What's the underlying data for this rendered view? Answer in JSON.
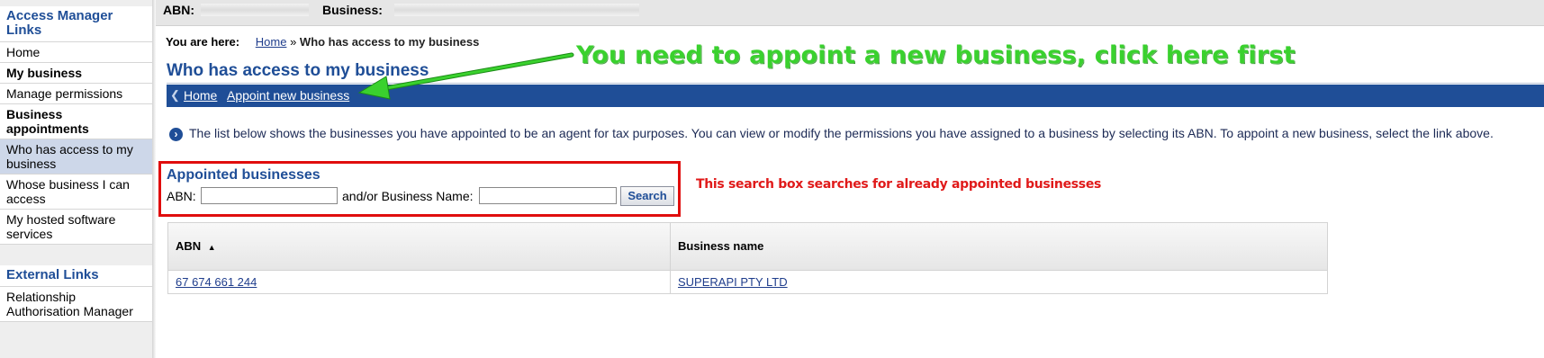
{
  "sidebar": {
    "title": "Access Manager Links",
    "items": [
      {
        "label": "Home"
      },
      {
        "label": "My business"
      },
      {
        "label": "Manage permissions"
      },
      {
        "label": "Business appointments"
      },
      {
        "label": "Who has access to my business"
      },
      {
        "label": "Whose business I can access"
      },
      {
        "label": "My hosted software services"
      }
    ],
    "selected": "Who has access to my business",
    "external_title": "External Links",
    "external_items": [
      {
        "label": "Relationship Authorisation Manager"
      }
    ]
  },
  "header": {
    "abn_label": "ABN:",
    "business_label": "Business:"
  },
  "breadcrumb": {
    "label": "You are here:",
    "home": "Home",
    "separator": "»",
    "current": "Who has access to my business"
  },
  "page_title": "Who has access to my business",
  "nav": {
    "back_icon": "chevron-left-icon",
    "home": "Home",
    "appoint": "Appoint new business"
  },
  "info": {
    "icon": "chevron-right-circle-icon",
    "text": "The list below shows the businesses you have appointed to be an agent for tax purposes. You can view or modify the permissions you have assigned to a business by selecting its ABN. To appoint a new business, select the link above."
  },
  "search": {
    "title": "Appointed businesses",
    "abn_label": "ABN:",
    "abn_value": "",
    "name_label": "and/or Business Name:",
    "name_value": "",
    "button": "Search"
  },
  "annotations": {
    "green": "You need to appoint a new business, click here first",
    "red": "This search box searches for already appointed businesses"
  },
  "table": {
    "columns": [
      "ABN",
      "Business name"
    ],
    "sort_icon": "sort-ascending-icon",
    "rows": [
      {
        "abn": "67 674 661 244",
        "name": "SUPERAPI PTY LTD"
      }
    ]
  },
  "colors": {
    "brand_blue": "#1f4e97",
    "annotation_green": "#3ad12e",
    "annotation_red": "#e00d0d",
    "selected_bg": "#cdd7e9"
  }
}
